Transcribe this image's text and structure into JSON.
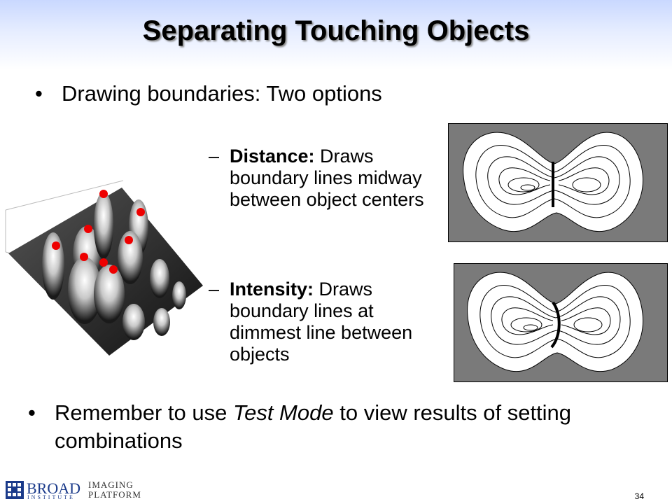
{
  "title": "Separating Touching Objects",
  "bullet1": {
    "marker": "•",
    "text": "Drawing boundaries: Two options"
  },
  "options": [
    {
      "marker": "–",
      "name": "Distance:",
      "desc": " Draws boundary lines midway between object centers"
    },
    {
      "marker": "–",
      "name": "Intensity:",
      "desc": " Draws boundary lines at dimmest line between objects"
    }
  ],
  "bullet2": {
    "marker": "•",
    "text_before": "Remember to use ",
    "text_italic": "Test Mode",
    "text_after": " to view results of setting combinations"
  },
  "footer": {
    "logo_word": "BROAD",
    "logo_sub": "INSTITUTE",
    "platform_line1": "IMAGING",
    "platform_line2": "PLATFORM",
    "page_number": "34"
  },
  "colors": {
    "panel_gray": "#7a7a7a",
    "seed_red": "#ee0000",
    "logo_blue": "#1a3a8a"
  }
}
